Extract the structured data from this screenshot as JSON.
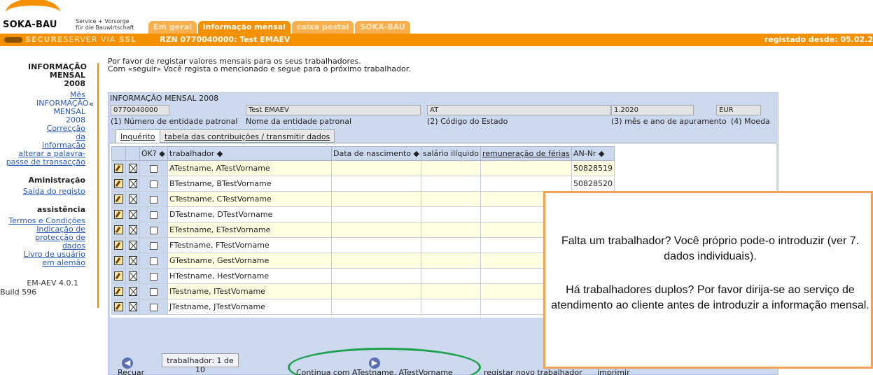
{
  "header": {
    "logo_text": "SOKA-BAU",
    "logo_sub_line1": "Service + Vorsorge",
    "logo_sub_line2": "für die Bauwirtschaft",
    "tabs": [
      {
        "label": "Em geral",
        "active": false
      },
      {
        "label": "informação mensal",
        "active": true
      },
      {
        "label": "caixa postal",
        "active": false
      },
      {
        "label": "SOKA-BAU",
        "active": false
      }
    ],
    "secure_label": "SECURE",
    "server_label": "SERVER VIA ",
    "ssl_label": "SSL",
    "rzn": "RZN 0770040000: Test EMAEV",
    "registered_since": "registado desde: 05.02.2"
  },
  "sidebar": {
    "heading": "INFORMAÇÃO MENSAL 2008",
    "links": [
      "Mês",
      "INFORMAÇÃO MENSAL 2008",
      "Correcção da informação",
      "alterar a palavra-passe de transacção"
    ],
    "admin_heading": "Aministração",
    "admin_link": "Saída do registo",
    "help_heading": "assistência",
    "help_links": [
      "Termos e Condições",
      "Indicação de protecção de dados",
      "Livro de usuário em alemão"
    ],
    "version_line1": "EM-AEV 4.0.1",
    "version_line2": "Build 596",
    "current_marker": "«"
  },
  "intro": {
    "line1": "Por favor de registar valores mensais para os seus trabalhadores.",
    "line2": "Com «seguir» Você regista o mencionado e segue para o próximo trabalhador."
  },
  "panel": {
    "title": "INFORMAÇÃO MENSAL 2008",
    "employer_number": "0770040000",
    "employer_name": "Test EMAEV",
    "state_code": "AT",
    "month_year": "1.2020",
    "currency": "EUR",
    "label_employer_number": "(1) Número de entidade patronal",
    "label_employer_name": "Nome da entidade patronal",
    "label_state_code": "(2) Código do Estado",
    "label_month_year": "(3) mês e ano de apuramento",
    "label_currency": "(4) Moeda",
    "tab_inquiry": "Inquérito",
    "tab_contributions": "tabela das contribuições / transmitir dados"
  },
  "table": {
    "headers": {
      "ok": "OK? ◆",
      "worker": "trabalhador ◆",
      "birth": "Data de nascimento ◆",
      "net_salary": "salário ilíquido",
      "holiday_pay": "remuneração de férias",
      "an_nr": "AN-Nr ◆"
    },
    "rows": [
      {
        "name": "ATestname, ATestVorname",
        "an_nr": "50828519"
      },
      {
        "name": "BTestname, BTestVorname",
        "an_nr": "50828520"
      },
      {
        "name": "CTestname, CTestVorname",
        "an_nr": ""
      },
      {
        "name": "DTestname, DTestVorname",
        "an_nr": ""
      },
      {
        "name": "ETestname, ETestVorname",
        "an_nr": ""
      },
      {
        "name": "FTestname, FTestVorname",
        "an_nr": ""
      },
      {
        "name": "GTestname, GestVorname",
        "an_nr": ""
      },
      {
        "name": "HTestname, HestVorname",
        "an_nr": ""
      },
      {
        "name": "ITestname, ITestVorname",
        "an_nr": ""
      },
      {
        "name": "JTestname, JTestVorname",
        "an_nr": ""
      }
    ]
  },
  "bottom": {
    "back_label": "Recuar",
    "counter": "trabalhador: 1 de 10",
    "continue_label": "Continua com ATestname, ATestVorname",
    "new_worker_label": "registar novo trabalhador",
    "print_label": "imprimir"
  },
  "callout": {
    "para1": "Falta um trabalhador? Você próprio pode-o introduzir (ver 7. dados individuais).",
    "para2": "Há trabalhadores duplos? Por favor dirija-se ao serviço de atendimento ao cliente antes de introduzir a informação mensal."
  },
  "colors": {
    "brand_orange": "#f39100",
    "panel_blue": "#ccd8ee",
    "highlight_green": "#1aa24a",
    "callout_border": "#f0a25a"
  },
  "icons": [
    "edit-icon",
    "delete-icon",
    "back-arrow-icon",
    "forward-arrow-icon",
    "add-person-icon",
    "key-icon"
  ]
}
